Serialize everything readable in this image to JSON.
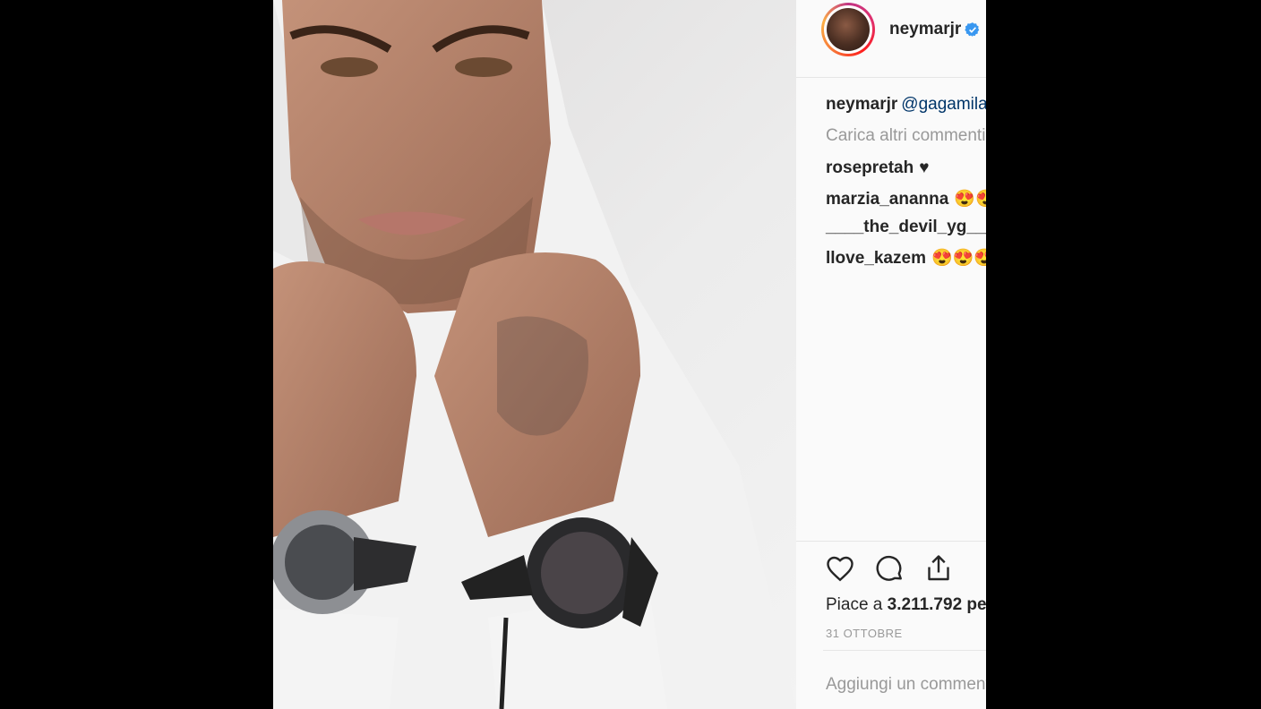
{
  "post": {
    "username": "neymarjr",
    "verified_icon": "verified-badge-icon",
    "photo_icon": "post-photo",
    "caption": {
      "user": "neymarjr",
      "mention": "@gagamila"
    },
    "load_more": "Carica altri commenti",
    "comments": [
      {
        "user": "rosepretah",
        "text": "♥"
      },
      {
        "user": "marzia_ananna",
        "text": "😍😍"
      },
      {
        "user": "____the_devil_yg____",
        "text": ""
      },
      {
        "user": "llove_kazem",
        "text": "😍😍😍"
      }
    ],
    "actions": {
      "like_icon": "heart-icon",
      "comment_icon": "comment-icon",
      "share_icon": "share-icon"
    },
    "likes": {
      "prefix": "Piace a ",
      "count": "3.211.792",
      "suffix": " persone"
    },
    "date": "31 OTTOBRE",
    "add_comment_placeholder": "Aggiungi un commento..."
  },
  "colors": {
    "accent_verified": "#3897f0",
    "mention": "#003569",
    "muted": "#999999",
    "background": "#fafafa"
  }
}
